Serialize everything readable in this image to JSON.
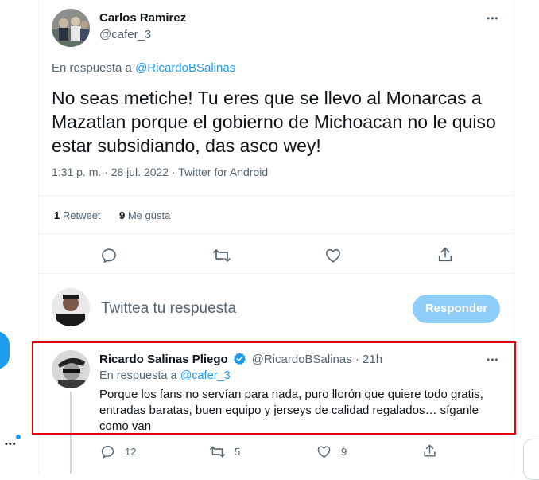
{
  "main_tweet": {
    "author_name": "Carlos Ramirez",
    "author_handle": "@cafer_3",
    "reply_prefix": "En respuesta a ",
    "reply_to": "@RicardoBSalinas",
    "text": "No seas metiche! Tu eres que se llevo al Monarcas a Mazatlan porque el gobierno de Michoacan no le quiso estar subsidiando, das asco wey!",
    "timestamp": "1:31 p. m. · 28 jul. 2022 · Twitter for Android",
    "retweet_count": "1",
    "retweet_label": " Retweet",
    "like_count": "9",
    "like_label": " Me gusta",
    "more_label": "•••"
  },
  "compose": {
    "placeholder": "Twittea tu respuesta",
    "button_label": "Responder"
  },
  "reply_tweet": {
    "author_name": "Ricardo Salinas Pliego",
    "author_handle": "@RicardoBSalinas",
    "time": " · 21h",
    "reply_prefix": "En respuesta a ",
    "reply_to": "@cafer_3",
    "text_line1": "Porque los fans no servían para nada, puro llorón que quiere todo gratis,",
    "text_line2": "entradas baratas, buen equipo y jerseys de calidad regalados… síganle",
    "text_line3": "como van",
    "reply_count": "12",
    "retweet_count": "5",
    "like_count": "9",
    "more_label": "•••"
  },
  "left_rail": {
    "more_label": "•••"
  },
  "colors": {
    "accent": "#1d9bf0",
    "button_disabled": "#8ecdf8",
    "highlight": "#e8000b",
    "verified": "#1d9bf0"
  },
  "icons": [
    "reply-icon",
    "retweet-icon",
    "like-icon",
    "share-icon",
    "verified-badge-icon",
    "more-icon"
  ]
}
